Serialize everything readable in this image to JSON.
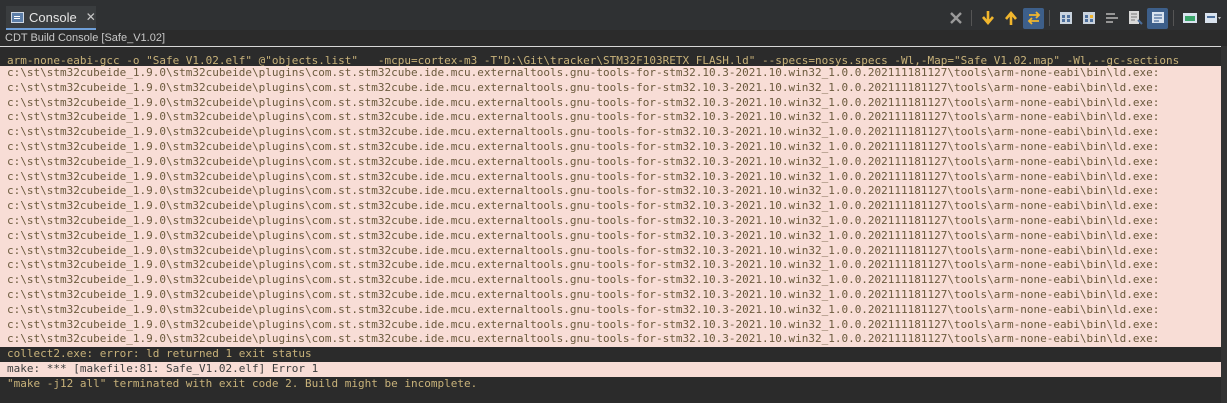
{
  "tab": {
    "label": "Console",
    "close_glyph": "✕",
    "icon": "console-icon"
  },
  "toolbar": {
    "buttons": [
      {
        "name": "clear-console-icon"
      },
      {
        "name": "next-error-icon"
      },
      {
        "name": "previous-error-icon"
      },
      {
        "name": "scroll-lock-icon"
      },
      {
        "name": "copy-build-log-icon"
      },
      {
        "name": "open-build-log-icon"
      },
      {
        "name": "word-wrap-icon"
      },
      {
        "name": "show-on-output-icon"
      },
      {
        "name": "pin-console-icon"
      },
      {
        "name": "display-selected-console-icon"
      },
      {
        "name": "open-console-icon"
      }
    ]
  },
  "console_title": "CDT Build Console [Safe_V1.02]",
  "output": {
    "command_line": "arm-none-eabi-gcc -o \"Safe_V1.02.elf\" @\"objects.list\"   -mcpu=cortex-m3 -T\"D:\\Git\\tracker\\STM32F103RETX_FLASH.ld\" --specs=nosys.specs -Wl,-Map=\"Safe_V1.02.map\" -Wl,--gc-sections",
    "ld_lines": [
      "c:\\st\\stm32cubeide_1.9.0\\stm32cubeide\\plugins\\com.st.stm32cube.ide.mcu.externaltools.gnu-tools-for-stm32.10.3-2021.10.win32_1.0.0.202111181127\\tools\\arm-none-eabi\\bin\\ld.exe:",
      "c:\\st\\stm32cubeide_1.9.0\\stm32cubeide\\plugins\\com.st.stm32cube.ide.mcu.externaltools.gnu-tools-for-stm32.10.3-2021.10.win32_1.0.0.202111181127\\tools\\arm-none-eabi\\bin\\ld.exe:",
      "c:\\st\\stm32cubeide_1.9.0\\stm32cubeide\\plugins\\com.st.stm32cube.ide.mcu.externaltools.gnu-tools-for-stm32.10.3-2021.10.win32_1.0.0.202111181127\\tools\\arm-none-eabi\\bin\\ld.exe:",
      "c:\\st\\stm32cubeide_1.9.0\\stm32cubeide\\plugins\\com.st.stm32cube.ide.mcu.externaltools.gnu-tools-for-stm32.10.3-2021.10.win32_1.0.0.202111181127\\tools\\arm-none-eabi\\bin\\ld.exe:",
      "c:\\st\\stm32cubeide_1.9.0\\stm32cubeide\\plugins\\com.st.stm32cube.ide.mcu.externaltools.gnu-tools-for-stm32.10.3-2021.10.win32_1.0.0.202111181127\\tools\\arm-none-eabi\\bin\\ld.exe:",
      "c:\\st\\stm32cubeide_1.9.0\\stm32cubeide\\plugins\\com.st.stm32cube.ide.mcu.externaltools.gnu-tools-for-stm32.10.3-2021.10.win32_1.0.0.202111181127\\tools\\arm-none-eabi\\bin\\ld.exe:",
      "c:\\st\\stm32cubeide_1.9.0\\stm32cubeide\\plugins\\com.st.stm32cube.ide.mcu.externaltools.gnu-tools-for-stm32.10.3-2021.10.win32_1.0.0.202111181127\\tools\\arm-none-eabi\\bin\\ld.exe:",
      "c:\\st\\stm32cubeide_1.9.0\\stm32cubeide\\plugins\\com.st.stm32cube.ide.mcu.externaltools.gnu-tools-for-stm32.10.3-2021.10.win32_1.0.0.202111181127\\tools\\arm-none-eabi\\bin\\ld.exe:",
      "c:\\st\\stm32cubeide_1.9.0\\stm32cubeide\\plugins\\com.st.stm32cube.ide.mcu.externaltools.gnu-tools-for-stm32.10.3-2021.10.win32_1.0.0.202111181127\\tools\\arm-none-eabi\\bin\\ld.exe:",
      "c:\\st\\stm32cubeide_1.9.0\\stm32cubeide\\plugins\\com.st.stm32cube.ide.mcu.externaltools.gnu-tools-for-stm32.10.3-2021.10.win32_1.0.0.202111181127\\tools\\arm-none-eabi\\bin\\ld.exe:",
      "c:\\st\\stm32cubeide_1.9.0\\stm32cubeide\\plugins\\com.st.stm32cube.ide.mcu.externaltools.gnu-tools-for-stm32.10.3-2021.10.win32_1.0.0.202111181127\\tools\\arm-none-eabi\\bin\\ld.exe:",
      "c:\\st\\stm32cubeide_1.9.0\\stm32cubeide\\plugins\\com.st.stm32cube.ide.mcu.externaltools.gnu-tools-for-stm32.10.3-2021.10.win32_1.0.0.202111181127\\tools\\arm-none-eabi\\bin\\ld.exe:",
      "c:\\st\\stm32cubeide_1.9.0\\stm32cubeide\\plugins\\com.st.stm32cube.ide.mcu.externaltools.gnu-tools-for-stm32.10.3-2021.10.win32_1.0.0.202111181127\\tools\\arm-none-eabi\\bin\\ld.exe:",
      "c:\\st\\stm32cubeide_1.9.0\\stm32cubeide\\plugins\\com.st.stm32cube.ide.mcu.externaltools.gnu-tools-for-stm32.10.3-2021.10.win32_1.0.0.202111181127\\tools\\arm-none-eabi\\bin\\ld.exe:",
      "c:\\st\\stm32cubeide_1.9.0\\stm32cubeide\\plugins\\com.st.stm32cube.ide.mcu.externaltools.gnu-tools-for-stm32.10.3-2021.10.win32_1.0.0.202111181127\\tools\\arm-none-eabi\\bin\\ld.exe:",
      "c:\\st\\stm32cubeide_1.9.0\\stm32cubeide\\plugins\\com.st.stm32cube.ide.mcu.externaltools.gnu-tools-for-stm32.10.3-2021.10.win32_1.0.0.202111181127\\tools\\arm-none-eabi\\bin\\ld.exe:",
      "c:\\st\\stm32cubeide_1.9.0\\stm32cubeide\\plugins\\com.st.stm32cube.ide.mcu.externaltools.gnu-tools-for-stm32.10.3-2021.10.win32_1.0.0.202111181127\\tools\\arm-none-eabi\\bin\\ld.exe:",
      "c:\\st\\stm32cubeide_1.9.0\\stm32cubeide\\plugins\\com.st.stm32cube.ide.mcu.externaltools.gnu-tools-for-stm32.10.3-2021.10.win32_1.0.0.202111181127\\tools\\arm-none-eabi\\bin\\ld.exe:",
      "c:\\st\\stm32cubeide_1.9.0\\stm32cubeide\\plugins\\com.st.stm32cube.ide.mcu.externaltools.gnu-tools-for-stm32.10.3-2021.10.win32_1.0.0.202111181127\\tools\\arm-none-eabi\\bin\\ld.exe:"
    ],
    "collect2_line": "collect2.exe: error: ld returned 1 exit status",
    "make_error_line": "make: *** [makefile:81: Safe_V1.02.elf] Error 1",
    "terminated_line": "\"make -j12 all\" terminated with exit code 2. Build might be incomplete."
  },
  "colors": {
    "background": "#2b2b2b",
    "error_background": "#f8ddd6",
    "output_text": "#c8b27a"
  }
}
